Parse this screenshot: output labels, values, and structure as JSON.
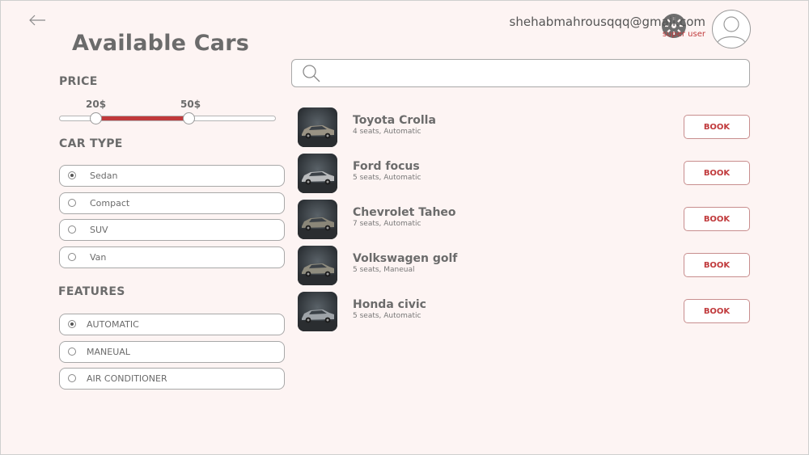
{
  "header": {
    "title": "Available Cars",
    "user_email": "shehabmahrousqqq@gmail.com",
    "user_role": "super user",
    "icons": {
      "back": "arrow-left-icon",
      "settings": "gear-icon",
      "avatar": "user-avatar-icon"
    }
  },
  "filters": {
    "price": {
      "title": "PRICE",
      "min_label": "20$",
      "max_label": "50$"
    },
    "car_type": {
      "title": "CAR TYPE",
      "options": [
        {
          "label": "Sedan",
          "checked": true
        },
        {
          "label": "Compact",
          "checked": false
        },
        {
          "label": "SUV",
          "checked": false
        },
        {
          "label": "Van",
          "checked": false
        }
      ]
    },
    "features": {
      "title": "FEATURES",
      "options": [
        {
          "label": "AUTOMATIC",
          "checked": true
        },
        {
          "label": "MANEUAL",
          "checked": false
        },
        {
          "label": "AIR CONDITIONER",
          "checked": false
        }
      ]
    }
  },
  "search": {
    "placeholder": "",
    "value": ""
  },
  "cars": [
    {
      "name": "Toyota Crolla",
      "meta": "4 seats, Automatic",
      "book_label": "BOOK",
      "color": "#9a9384"
    },
    {
      "name": "Ford focus",
      "meta": "5 seats, Automatic",
      "book_label": "BOOK",
      "color": "#b9bbbd"
    },
    {
      "name": "Chevrolet Taheo",
      "meta": "7 seats, Automatic",
      "book_label": "BOOK",
      "color": "#8a8678"
    },
    {
      "name": "Volkswagen golf",
      "meta": "5 seats, Maneual",
      "book_label": "BOOK",
      "color": "#8f8c7e"
    },
    {
      "name": "Honda civic",
      "meta": "5 seats, Automatic",
      "book_label": "BOOK",
      "color": "#9ea3a8"
    }
  ],
  "colors": {
    "accent": "#c0393b",
    "background": "#fdf4f3",
    "text": "#6b6b6b"
  }
}
